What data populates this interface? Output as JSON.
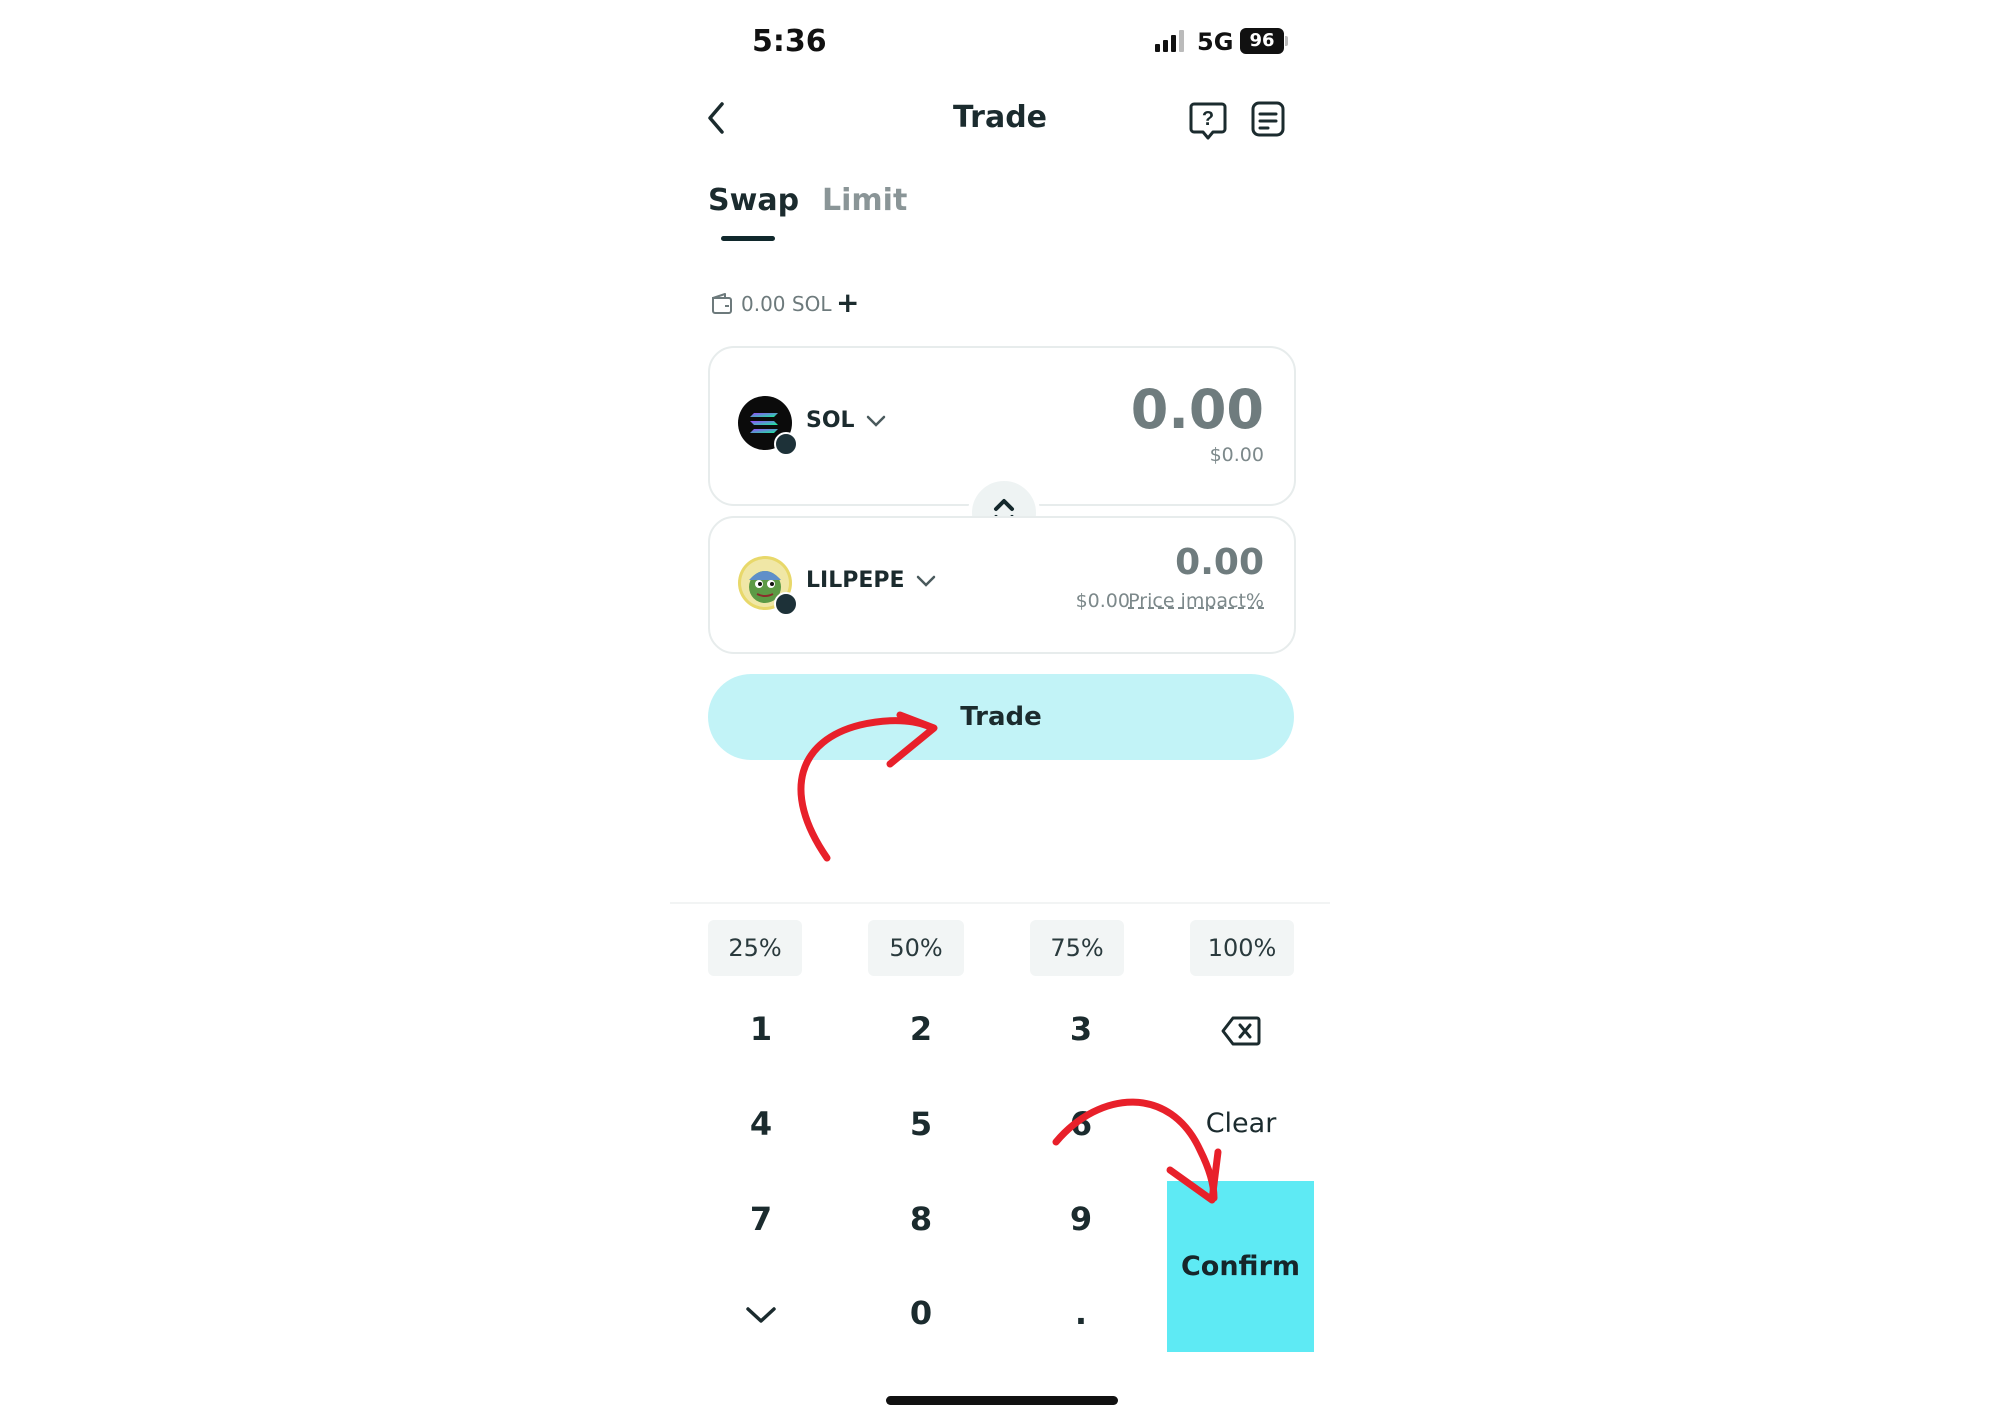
{
  "status_bar": {
    "time": "5:36",
    "network": "5G",
    "battery": "96"
  },
  "header": {
    "title": "Trade"
  },
  "tabs": [
    {
      "label": "Swap",
      "active": true
    },
    {
      "label": "Limit",
      "active": false
    }
  ],
  "balance": {
    "text": "0.00 SOL",
    "add_symbol": "+"
  },
  "from_token": {
    "symbol": "SOL",
    "amount": "0.00",
    "usd": "$0.00"
  },
  "to_token": {
    "symbol": "LILPEPE",
    "amount": "0.00",
    "usd": "$0.00",
    "price_impact_label": "Price impact%"
  },
  "trade_button": "Trade",
  "percent_buttons": [
    "25%",
    "50%",
    "75%",
    "100%"
  ],
  "keypad": {
    "keys": [
      "1",
      "2",
      "3",
      "4",
      "5",
      "6",
      "7",
      "8",
      "9",
      "0",
      "."
    ],
    "clear_label": "Clear",
    "confirm_label": "Confirm"
  },
  "colors": {
    "accent": "#5eeaf4",
    "trade_button_bg": "#c2f3f7",
    "annotation_arrow": "#e8202a"
  },
  "icons": [
    "back-arrow-icon",
    "help-icon",
    "history-icon",
    "wallet-icon",
    "chevron-down-icon",
    "swap-arrows-icon",
    "backspace-icon",
    "collapse-keyboard-icon"
  ]
}
